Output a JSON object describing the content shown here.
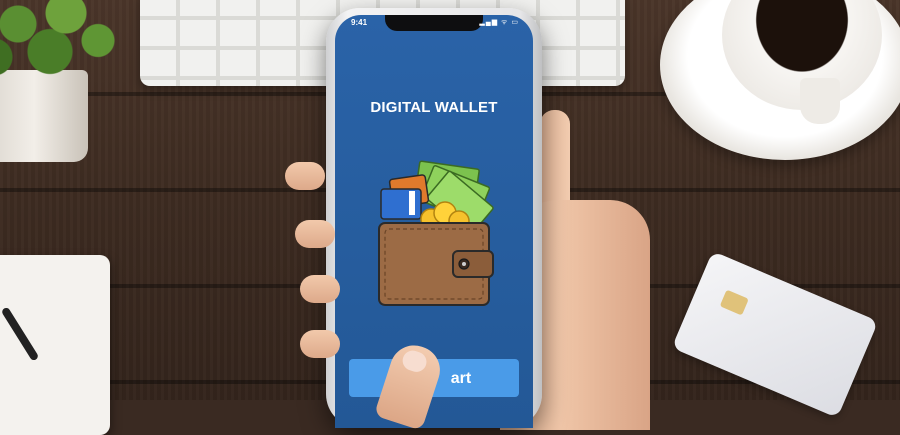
{
  "status_bar": {
    "time": "9:41",
    "icons": "▂▄▆ ᯤ ▭"
  },
  "app": {
    "title": "DIGITAL WALLET",
    "start_button_label": "art"
  },
  "colors": {
    "screen_background": "#2a63a8",
    "button_background": "#4a9be8",
    "title_text": "#ffffff"
  },
  "icons": {
    "illustration": "wallet-icon",
    "money": "banknotes-icon",
    "coins": "coins-icon",
    "cards": "credit-cards-icon"
  }
}
